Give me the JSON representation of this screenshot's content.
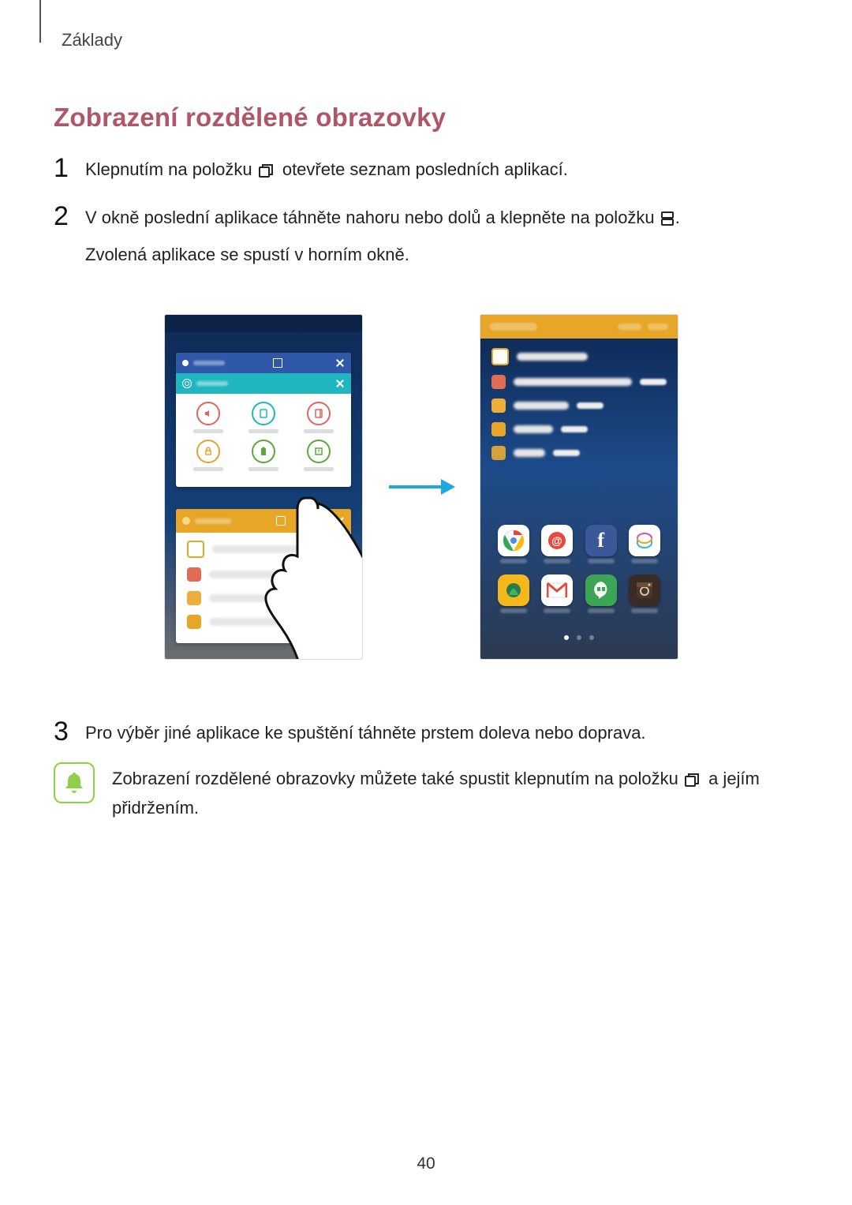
{
  "header": {
    "breadcrumb": "Základy"
  },
  "title": "Zobrazení rozdělené obrazovky",
  "steps": {
    "s1": {
      "num": "1",
      "pre": "Klepnutím na položku ",
      "post": " otevřete seznam posledních aplikací."
    },
    "s2": {
      "num": "2",
      "line1_pre": "V okně poslední aplikace táhněte nahoru nebo dolů a klepněte na položku ",
      "line1_post": ".",
      "line2": "Zvolená aplikace se spustí v horním okně."
    },
    "s3": {
      "num": "3",
      "text": "Pro výběr jiné aplikace ke spuštění táhněte prstem doleva nebo doprava."
    }
  },
  "note": {
    "pre": "Zobrazení rozdělené obrazovky můžete také spustit klepnutím na položku ",
    "post": " a jejím přidržením."
  },
  "icons": {
    "recent": "recent-apps-icon",
    "split": "split-window-icon",
    "bell": "bell-icon"
  },
  "page_number": "40"
}
